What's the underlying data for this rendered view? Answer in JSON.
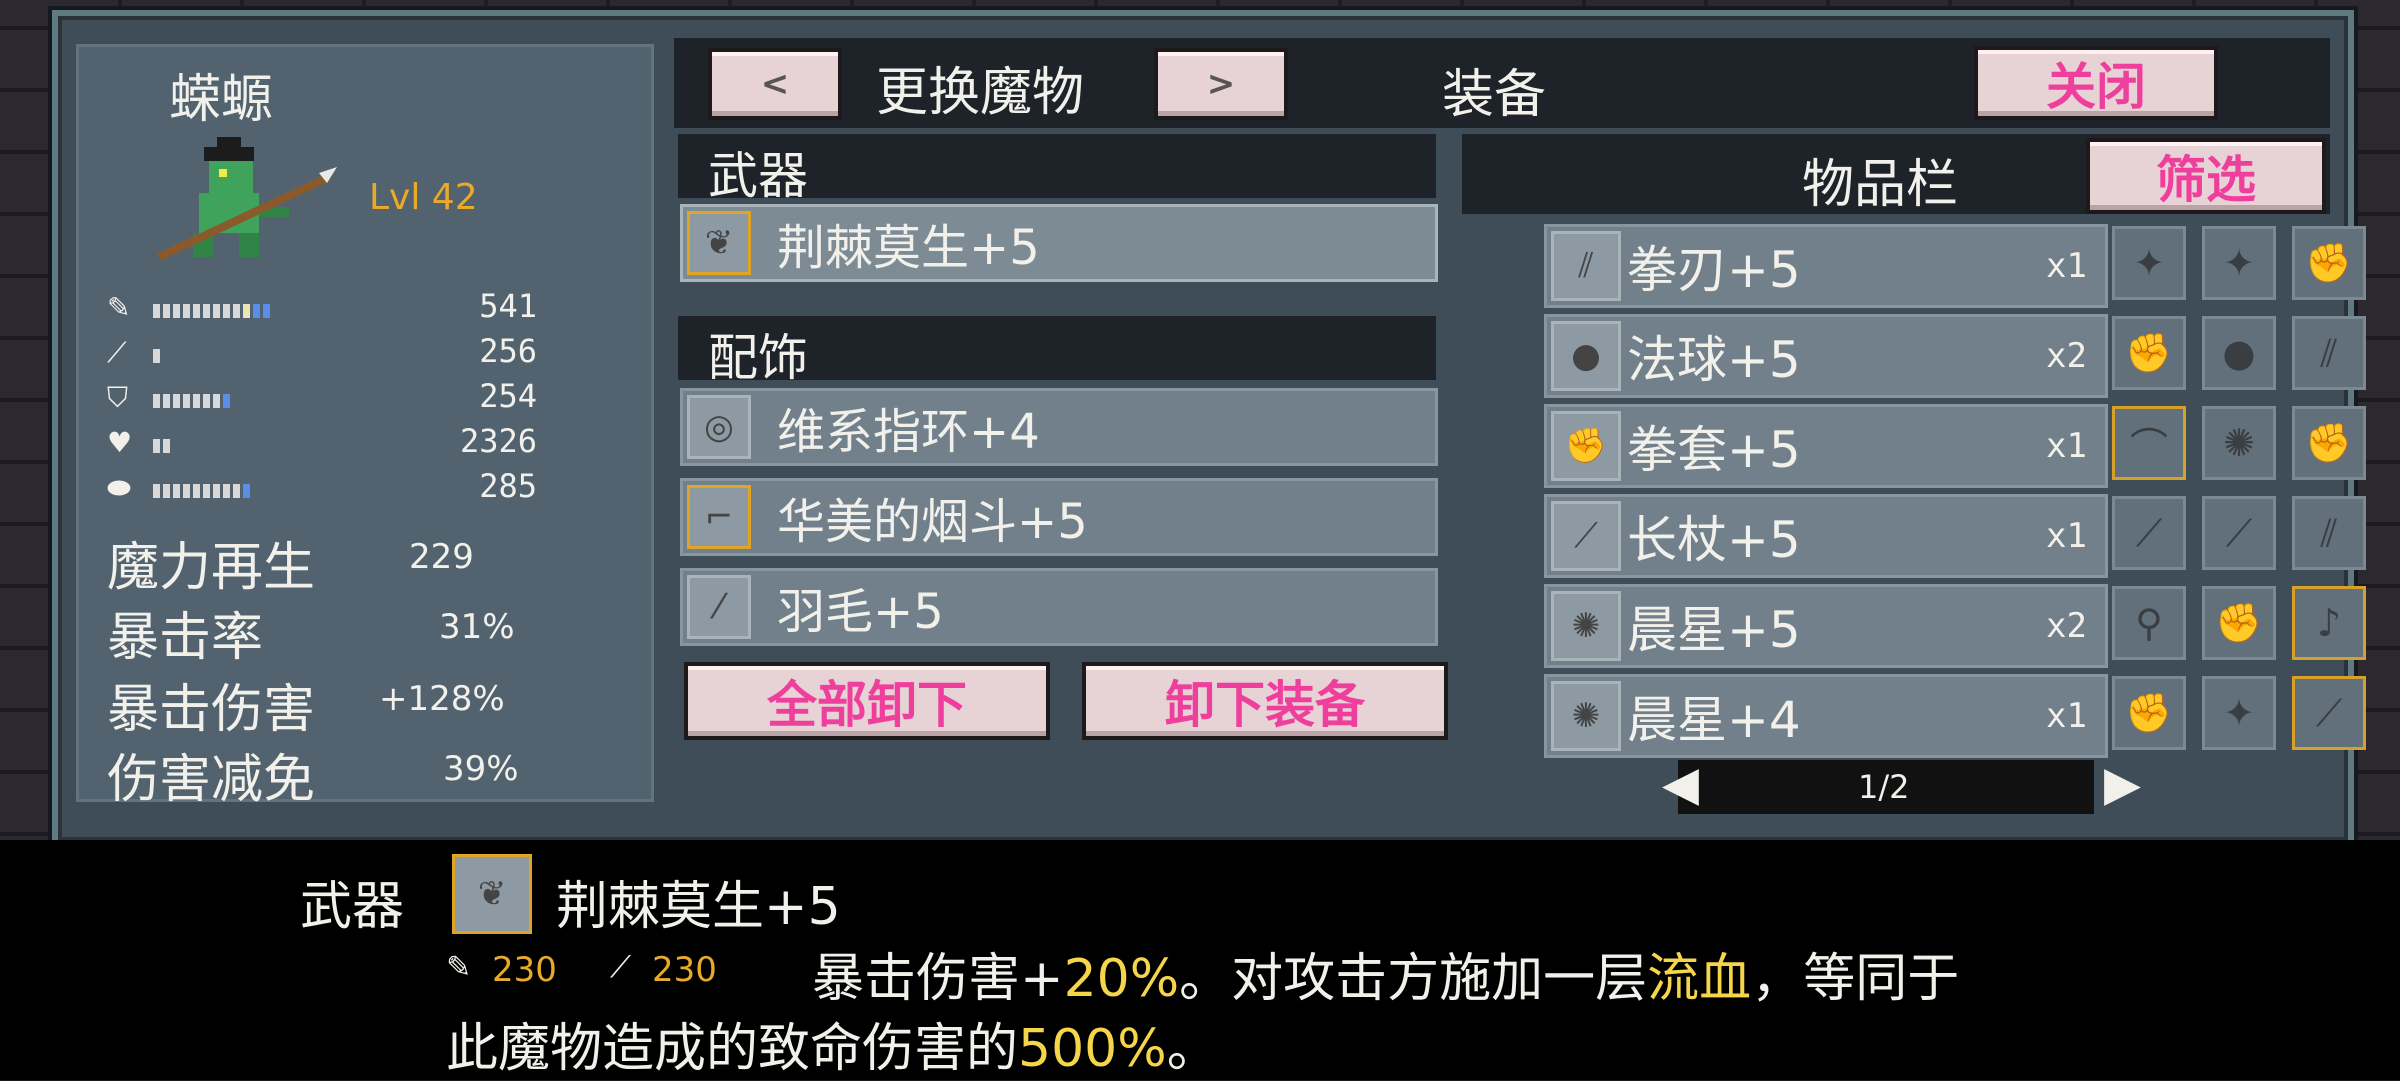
{
  "monster": {
    "name": "蝾螈",
    "level": "Lvl 42",
    "stats": [
      {
        "icon": "sword-icon",
        "value": "541"
      },
      {
        "icon": "wand-icon",
        "value": "256"
      },
      {
        "icon": "shield-icon",
        "value": "254"
      },
      {
        "icon": "heart-icon",
        "value": "2326"
      },
      {
        "icon": "potion-icon",
        "value": "285"
      }
    ],
    "derived": [
      {
        "label": "魔力再生",
        "value": "229"
      },
      {
        "label": "暴击率",
        "value": "31%"
      },
      {
        "label": "暴击伤害",
        "value": "+128%"
      },
      {
        "label": "伤害减免",
        "value": "39%"
      }
    ]
  },
  "header": {
    "prev": "<",
    "change_monster": "更换魔物",
    "next": ">",
    "equipment": "装备",
    "close": "关闭"
  },
  "equipment": {
    "weapon_label": "武器",
    "weapon": {
      "name": "荆棘莫生+5",
      "icon": "thorn-icon"
    },
    "accessory_label": "配饰",
    "accessories": [
      {
        "name": "维系指环+4",
        "icon": "ring-icon"
      },
      {
        "name": "华美的烟斗+5",
        "icon": "pipe-icon"
      },
      {
        "name": "羽毛+5",
        "icon": "feather-icon"
      }
    ],
    "unequip_all": "全部卸下",
    "unequip": "卸下装备"
  },
  "inventory": {
    "title": "物品栏",
    "filter": "筛选",
    "items": [
      {
        "name": "拳刃+5",
        "count": "x1",
        "icon": "claw-icon"
      },
      {
        "name": "法球+5",
        "count": "x2",
        "icon": "orb-icon"
      },
      {
        "name": "拳套+5",
        "count": "x1",
        "icon": "gauntlet-icon"
      },
      {
        "name": "长杖+5",
        "count": "x1",
        "icon": "staff-icon"
      },
      {
        "name": "晨星+5",
        "count": "x2",
        "icon": "morningstar-icon"
      },
      {
        "name": "晨星+4",
        "count": "x1",
        "icon": "morningstar-icon"
      }
    ],
    "page": "1/2"
  },
  "detail": {
    "category": "武器",
    "name": "荆棘莫生+5",
    "attack": "230",
    "magic": "230",
    "desc_1": "暴击伤害+",
    "desc_2": "20%",
    "desc_3": "。对攻击方施加一层",
    "desc_4": "流血",
    "desc_5": "，等同于",
    "desc_6": "此魔物造成的致命伤害的",
    "desc_7": "500%",
    "desc_8": "。"
  },
  "colors": {
    "accent_pink": "#ef3f9c",
    "gold": "#e0a526",
    "yellow_text": "#f5d54a"
  }
}
